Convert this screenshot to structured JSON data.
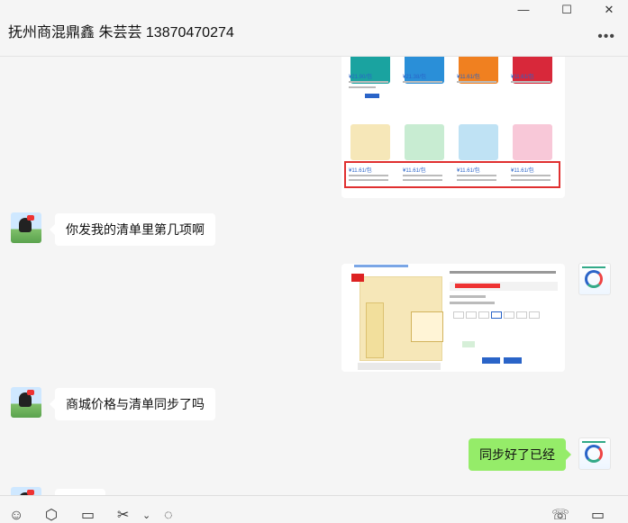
{
  "window": {
    "title": "抚州商混鼎鑫 朱芸芸 13870470274",
    "minimize_icon": "minimize-icon",
    "maximize_icon": "maximize-icon",
    "close_icon": "close-icon",
    "more_icon": "more-icon"
  },
  "messages": [
    {
      "side": "left",
      "type": "text",
      "text": "你发我的清单里第几项啊"
    },
    {
      "side": "right",
      "type": "image",
      "description_icon": "product-detail-image"
    },
    {
      "side": "left",
      "type": "text",
      "text": "商城价格与清单同步了吗"
    },
    {
      "side": "right",
      "type": "text",
      "text": "同步好了已经"
    }
  ],
  "product_grid": {
    "top_row_prices": [
      "¥21.90/包",
      "¥21.38/包",
      "¥11.61/包",
      "¥11.61/包"
    ],
    "bottom_row_prices": [
      "¥11.61/包",
      "¥11.61/包",
      "¥11.61/包",
      "¥11.61/包"
    ],
    "top_colors": [
      "#1aa3a0",
      "#2a8fd8",
      "#f08020",
      "#d8283a"
    ],
    "bottom_colors": [
      "#f6e7b8",
      "#c8ecd2",
      "#bfe2f4",
      "#f8c8d8"
    ]
  },
  "toolbar": {
    "icons": [
      "emoji-icon",
      "folder-icon",
      "screenshot-icon",
      "chat-history-icon",
      "voice-call-icon",
      "video-call-icon"
    ]
  },
  "colors": {
    "sent_bubble": "#95ec69",
    "received_bubble": "#ffffff",
    "background": "#f5f5f5"
  }
}
